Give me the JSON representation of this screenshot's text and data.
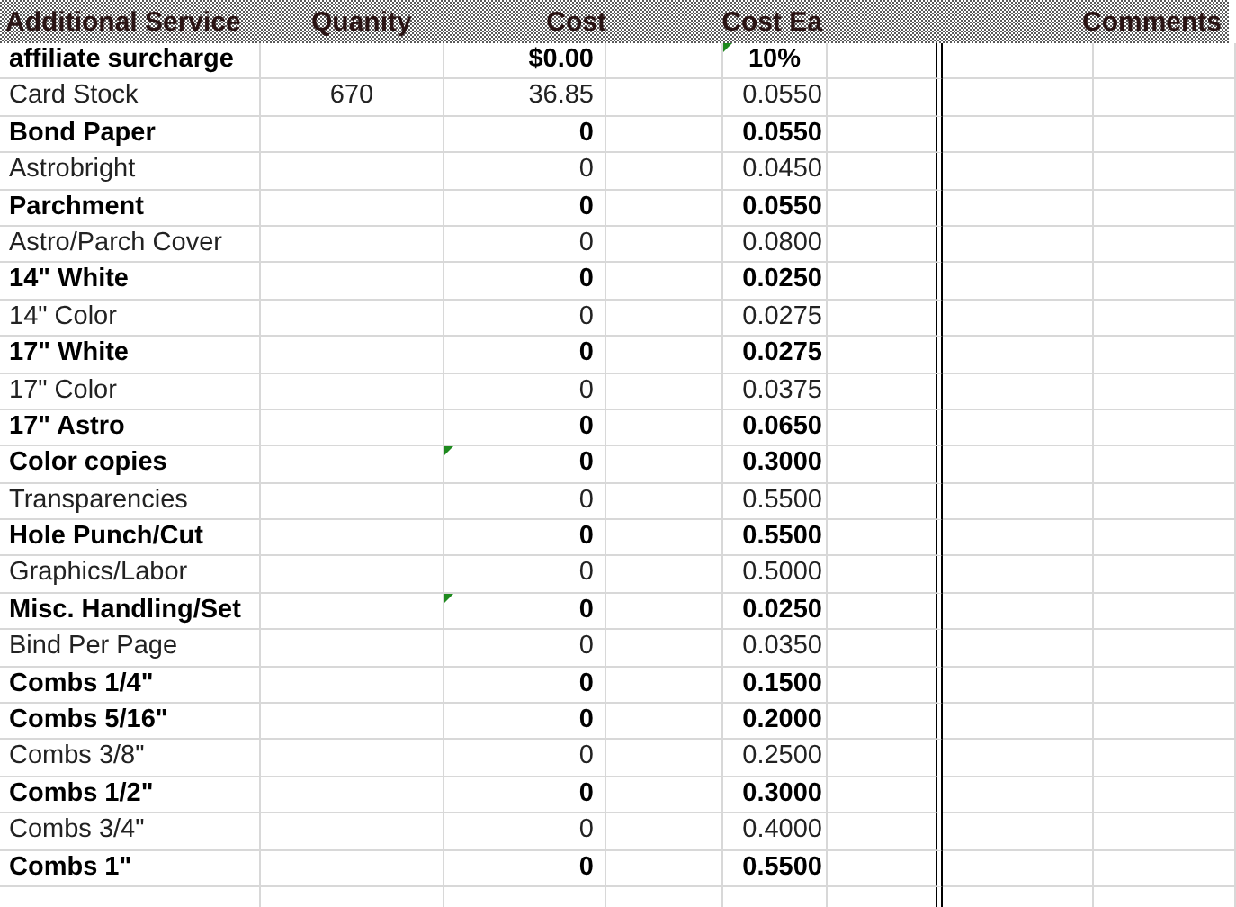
{
  "headers": [
    "Additional Service",
    "Quanity",
    "Cost",
    "Cost Ea",
    "Comments"
  ],
  "rows": [
    {
      "kind": "surcharge",
      "service": "affiliate surcharge",
      "quantity": "",
      "cost": "$0.00",
      "cost_each": "10%",
      "bold": true,
      "cost_flag": false,
      "rate_flag": true
    },
    {
      "kind": "item",
      "service": "Card Stock",
      "quantity": "670",
      "cost": "36.85",
      "cost_each": "0.0550",
      "bold": false,
      "cost_flag": false,
      "rate_flag": false
    },
    {
      "kind": "item",
      "service": "Bond Paper",
      "quantity": "",
      "cost": "0",
      "cost_each": "0.0550",
      "bold": true,
      "cost_flag": false,
      "rate_flag": false
    },
    {
      "kind": "item",
      "service": "Astrobright",
      "quantity": "",
      "cost": "0",
      "cost_each": "0.0450",
      "bold": false,
      "cost_flag": false,
      "rate_flag": false
    },
    {
      "kind": "item",
      "service": "Parchment",
      "quantity": "",
      "cost": "0",
      "cost_each": "0.0550",
      "bold": true,
      "cost_flag": false,
      "rate_flag": false
    },
    {
      "kind": "item",
      "service": "Astro/Parch Cover",
      "quantity": "",
      "cost": "0",
      "cost_each": "0.0800",
      "bold": false,
      "cost_flag": false,
      "rate_flag": false
    },
    {
      "kind": "item",
      "service": "14\" White",
      "quantity": "",
      "cost": "0",
      "cost_each": "0.0250",
      "bold": true,
      "cost_flag": false,
      "rate_flag": false
    },
    {
      "kind": "item",
      "service": "14\" Color",
      "quantity": "",
      "cost": "0",
      "cost_each": "0.0275",
      "bold": false,
      "cost_flag": false,
      "rate_flag": false
    },
    {
      "kind": "item",
      "service": "17\" White",
      "quantity": "",
      "cost": "0",
      "cost_each": "0.0275",
      "bold": true,
      "cost_flag": false,
      "rate_flag": false
    },
    {
      "kind": "item",
      "service": "17\" Color",
      "quantity": "",
      "cost": "0",
      "cost_each": "0.0375",
      "bold": false,
      "cost_flag": false,
      "rate_flag": false
    },
    {
      "kind": "item",
      "service": "17\" Astro",
      "quantity": "",
      "cost": "0",
      "cost_each": "0.0650",
      "bold": true,
      "cost_flag": false,
      "rate_flag": false
    },
    {
      "kind": "item",
      "service": "Color copies",
      "quantity": "",
      "cost": "0",
      "cost_each": "0.3000",
      "bold": true,
      "cost_flag": true,
      "rate_flag": false
    },
    {
      "kind": "item",
      "service": "Transparencies",
      "quantity": "",
      "cost": "0",
      "cost_each": "0.5500",
      "bold": false,
      "cost_flag": false,
      "rate_flag": false
    },
    {
      "kind": "item",
      "service": "Hole Punch/Cut",
      "quantity": "",
      "cost": "0",
      "cost_each": "0.5500",
      "bold": true,
      "cost_flag": false,
      "rate_flag": false
    },
    {
      "kind": "item",
      "service": "Graphics/Labor",
      "quantity": "",
      "cost": "0",
      "cost_each": "0.5000",
      "bold": false,
      "cost_flag": false,
      "rate_flag": false
    },
    {
      "kind": "item",
      "service": "Misc. Handling/Set",
      "quantity": "",
      "cost": "0",
      "cost_each": "0.0250",
      "bold": true,
      "cost_flag": true,
      "rate_flag": false
    },
    {
      "kind": "item",
      "service": "Bind Per Page",
      "quantity": "",
      "cost": "0",
      "cost_each": "0.0350",
      "bold": false,
      "cost_flag": false,
      "rate_flag": false
    },
    {
      "kind": "item",
      "service": "Combs 1/4\"",
      "quantity": "",
      "cost": "0",
      "cost_each": "0.1500",
      "bold": true,
      "cost_flag": false,
      "rate_flag": false
    },
    {
      "kind": "item",
      "service": "Combs 5/16\"",
      "quantity": "",
      "cost": "0",
      "cost_each": "0.2000",
      "bold": true,
      "cost_flag": false,
      "rate_flag": false
    },
    {
      "kind": "item",
      "service": "Combs 3/8\"",
      "quantity": "",
      "cost": "0",
      "cost_each": "0.2500",
      "bold": false,
      "cost_flag": false,
      "rate_flag": false
    },
    {
      "kind": "item",
      "service": "Combs 1/2\"",
      "quantity": "",
      "cost": "0",
      "cost_each": "0.3000",
      "bold": true,
      "cost_flag": false,
      "rate_flag": false
    },
    {
      "kind": "item",
      "service": "Combs 3/4\"",
      "quantity": "",
      "cost": "0",
      "cost_each": "0.4000",
      "bold": false,
      "cost_flag": false,
      "rate_flag": false
    },
    {
      "kind": "item",
      "service": "Combs 1\"",
      "quantity": "",
      "cost": "0",
      "cost_each": "0.5500",
      "bold": true,
      "cost_flag": false,
      "rate_flag": false
    }
  ]
}
